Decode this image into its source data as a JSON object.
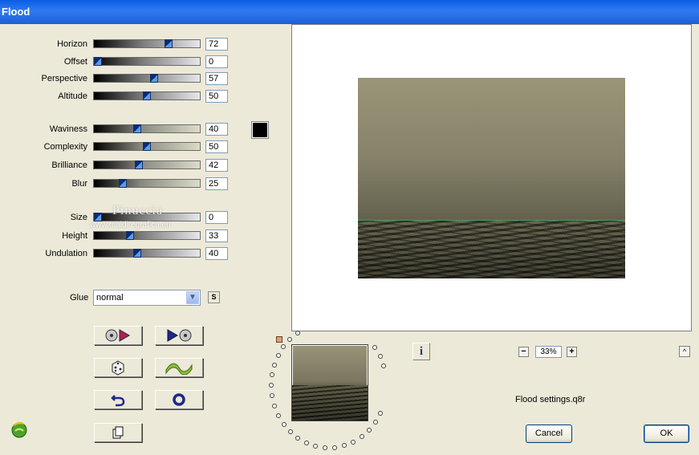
{
  "window": {
    "title": "Flood"
  },
  "sliders": [
    {
      "label": "Horizon",
      "value": "72",
      "fraction": 0.72
    },
    {
      "label": "Offset",
      "value": "0",
      "fraction": 0.0
    },
    {
      "label": "Perspective",
      "value": "57",
      "fraction": 0.57
    },
    {
      "label": "Altitude",
      "value": "50",
      "fraction": 0.5
    },
    {
      "label": "Waviness",
      "value": "40",
      "fraction": 0.4
    },
    {
      "label": "Complexity",
      "value": "50",
      "fraction": 0.5
    },
    {
      "label": "Brilliance",
      "value": "42",
      "fraction": 0.42
    },
    {
      "label": "Blur",
      "value": "25",
      "fraction": 0.25
    },
    {
      "label": "Size",
      "value": "0",
      "fraction": 0.0
    },
    {
      "label": "Height",
      "value": "33",
      "fraction": 0.33
    },
    {
      "label": "Undulation",
      "value": "40",
      "fraction": 0.4
    }
  ],
  "color_swatch": "#000000",
  "glue": {
    "label": "Glue",
    "value": "normal",
    "side_button": "S"
  },
  "zoom": {
    "value": "33%",
    "minus": "−",
    "plus": "+"
  },
  "preset": {
    "filename": "Flood settings.q8r"
  },
  "buttons": {
    "cancel": "Cancel",
    "ok": "OK",
    "info": "i",
    "up": "^"
  },
  "watermark": {
    "name": "Pinuccia",
    "site": "www.maidiregrafica.eu"
  },
  "colors": {
    "titlebar": "#0a5de3",
    "horizon_line": "#3ad34f"
  }
}
